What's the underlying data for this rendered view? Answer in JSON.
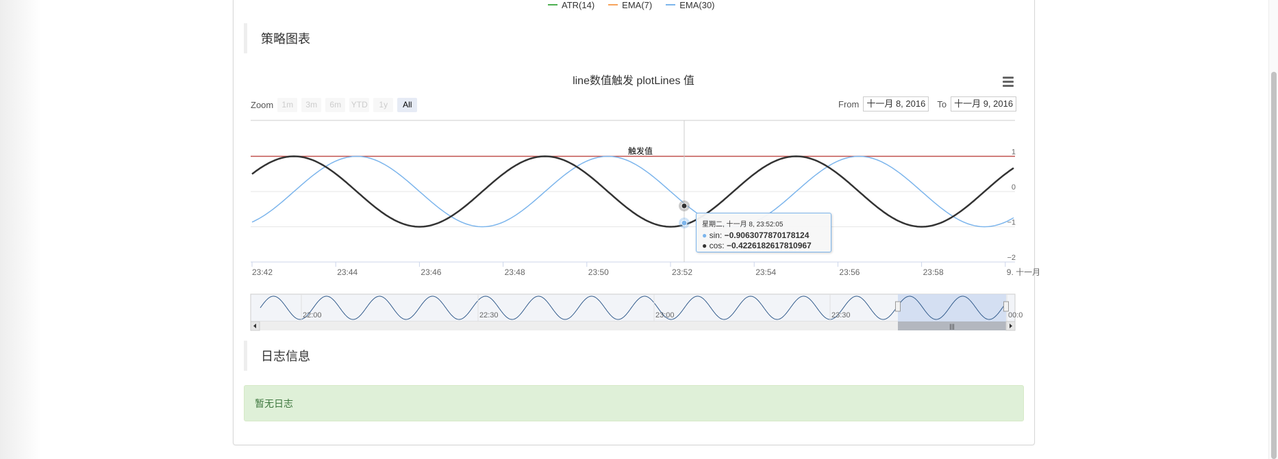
{
  "legend": [
    {
      "label": "ATR(14)",
      "color": "#4caf50"
    },
    {
      "label": "EMA(7)",
      "color": "#f7a35c"
    },
    {
      "label": "EMA(30)",
      "color": "#7cb5ec"
    }
  ],
  "sections": {
    "strategy_chart": "策略图表",
    "log_info": "日志信息"
  },
  "chart": {
    "title": "line数值触发 plotLines 值",
    "menu_icon": "hamburger-menu-icon",
    "range_selector": {
      "zoom_label": "Zoom",
      "buttons": [
        "1m",
        "3m",
        "6m",
        "YTD",
        "1y",
        "All"
      ],
      "selected": "All",
      "from_label": "From",
      "from_value": "十一月 8, 2016",
      "to_label": "To",
      "to_value": "十一月 9, 2016"
    },
    "plotline_label": "触发值",
    "tooltip": {
      "header": "星期二, 十一月 8, 23:52:05",
      "sin_label": "sin: ",
      "sin_value": "−0.9063077870178124",
      "cos_label": "cos: ",
      "cos_value": "−0.4226182617810967"
    },
    "navigator_labels": [
      "22:00",
      "22:30",
      "23:00",
      "23:30",
      "00:0"
    ],
    "colors": {
      "sin": "#7cb5ec",
      "cos": "#333333",
      "plotline": "#c0504d",
      "navigator_fill": "#ccdaf0"
    }
  },
  "chart_data": {
    "type": "line",
    "title": "line数值触发 plotLines 值",
    "x_tick_labels": [
      "23:42",
      "23:44",
      "23:46",
      "23:48",
      "23:50",
      "23:52",
      "23:54",
      "23:56",
      "23:58",
      "9. 十一月"
    ],
    "y_tick_labels": [
      "1",
      "0",
      "−1",
      "−2"
    ],
    "ylim": [
      -2,
      1
    ],
    "x_minutes_range": [
      0,
      18.3
    ],
    "plot_lines": [
      {
        "value": 1,
        "label": "触发值",
        "color": "#c0504d"
      }
    ],
    "series": [
      {
        "name": "sin",
        "function": "sin",
        "period_minutes": 6,
        "color": "#7cb5ec"
      },
      {
        "name": "cos",
        "function": "cos",
        "period_minutes": 6,
        "color": "#333333"
      }
    ],
    "crosshair_x": "23:52:05",
    "grid": true
  },
  "log": {
    "empty_text": "暂无日志"
  }
}
